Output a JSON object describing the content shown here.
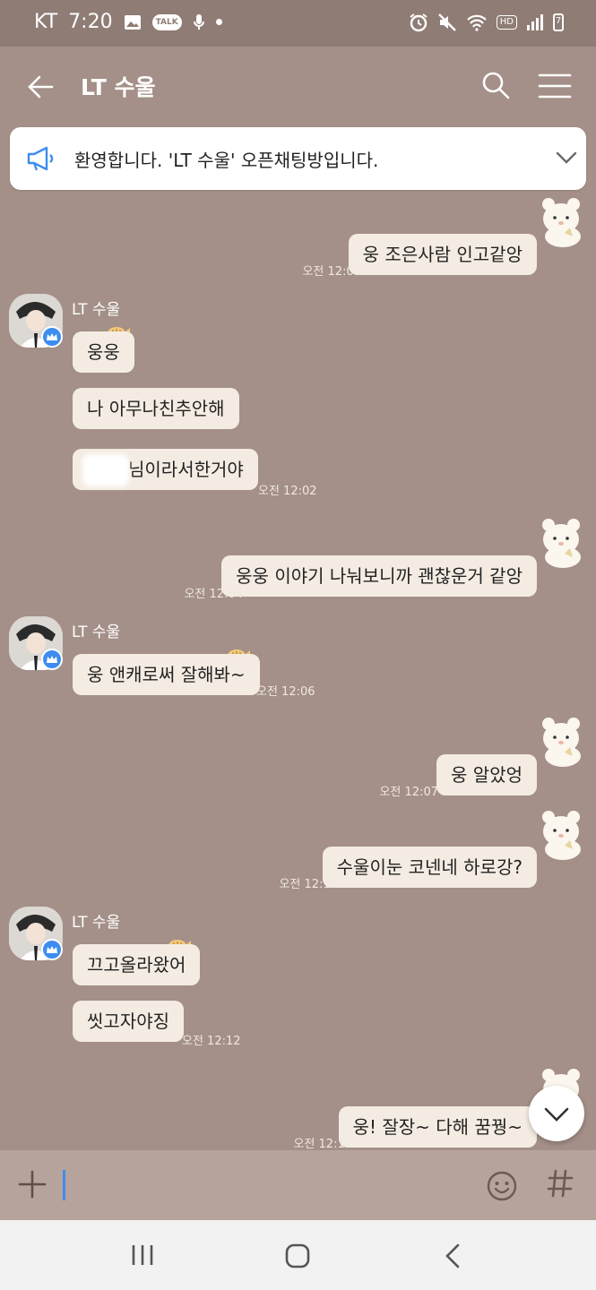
{
  "status": {
    "carrier": "KT",
    "time": "7:20",
    "talk_badge": "TALK",
    "hd": "HD",
    "battery": "7"
  },
  "header": {
    "title": "LT 수울"
  },
  "notice": {
    "text": "환영합니다. 'LT 수울' 오픈채팅방입니다."
  },
  "messages": [
    {
      "side": "me",
      "text": "웅 조은사람 인고같앙",
      "time": "오전 12:01"
    },
    {
      "side": "other",
      "sender": "LT 수울",
      "text": "웅웅"
    },
    {
      "side": "other",
      "text": "나 아무나친추안해"
    },
    {
      "side": "other",
      "text": "님이라서한거야",
      "time": "오전 12:02"
    },
    {
      "side": "me",
      "text": "웅웅 이야기 나눠보니까 괜찮운거 같앙",
      "time": "오전 12:04"
    },
    {
      "side": "other",
      "sender": "LT 수울",
      "text": "웅 앤캐로써 잘해봐~",
      "time": "오전 12:06"
    },
    {
      "side": "me",
      "text": "웅 알았엉",
      "time": "오전 12:07"
    },
    {
      "side": "me",
      "text": "수울이눈 코넨네 하로강?",
      "time": "오전 12:11"
    },
    {
      "side": "other",
      "sender": "LT 수울",
      "text": "끄고올라왔어"
    },
    {
      "side": "other",
      "text": "씻고자야징",
      "time": "오전 12:12"
    },
    {
      "side": "me",
      "text": "웅! 잘장~ 다해 꿈꿩~",
      "time": "오전 12:12"
    }
  ],
  "input": {
    "placeholder": ""
  },
  "icons": {
    "back": "arrow-left-icon",
    "search": "search-icon",
    "menu": "hamburger-icon",
    "notice": "megaphone-icon",
    "expand": "chevron-down-icon",
    "attach": "plus-icon",
    "emoji": "smiley-icon",
    "hashtag": "hash-icon",
    "nav_recent": "recent-apps-icon",
    "nav_home": "home-icon",
    "nav_back": "nav-back-icon"
  },
  "colors": {
    "background": "#a49088",
    "bubble": "#f4ece2",
    "accent": "#3d8df0"
  }
}
